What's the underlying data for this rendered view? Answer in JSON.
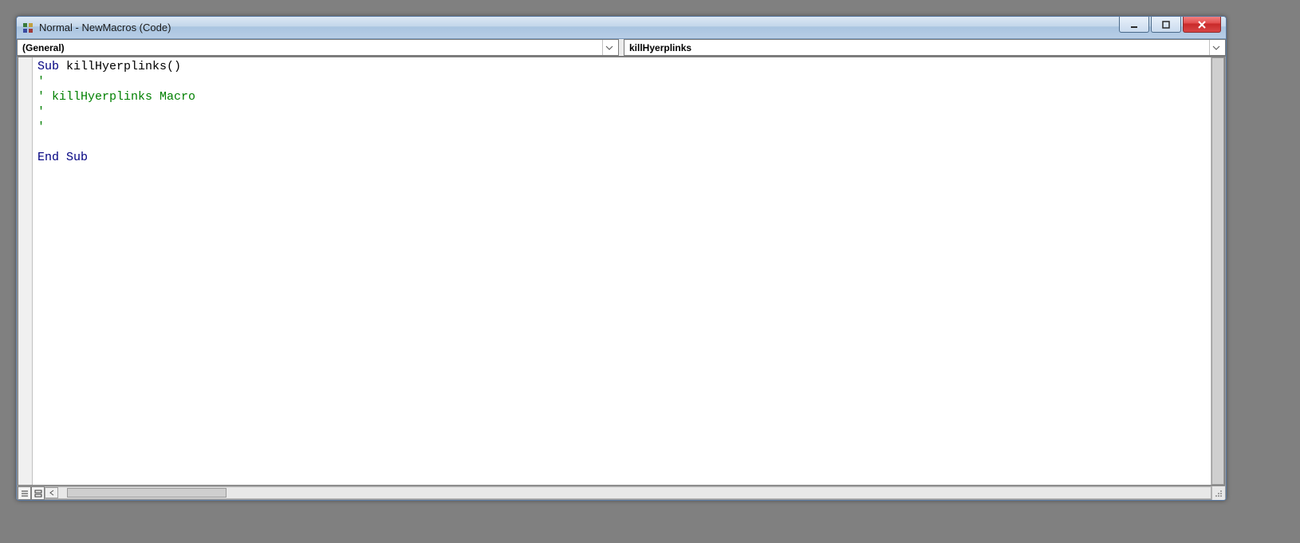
{
  "window": {
    "title": "Normal - NewMacros (Code)"
  },
  "dropdowns": {
    "object": "(General)",
    "procedure": "killHyerplinks"
  },
  "code": {
    "line1_kw1": "Sub",
    "line1_rest": " killHyerplinks()",
    "line2": "'",
    "line3": "' killHyerplinks Macro",
    "line4": "'",
    "line5": "'",
    "line6": "",
    "line7": "End Sub"
  },
  "icons": {
    "minimize": "minimize-icon",
    "maximize": "maximize-icon",
    "close": "close-icon",
    "chevron": "chevron-down-icon",
    "app": "vba-module-icon",
    "view_proc": "procedure-view-icon",
    "view_full": "full-module-view-icon"
  }
}
